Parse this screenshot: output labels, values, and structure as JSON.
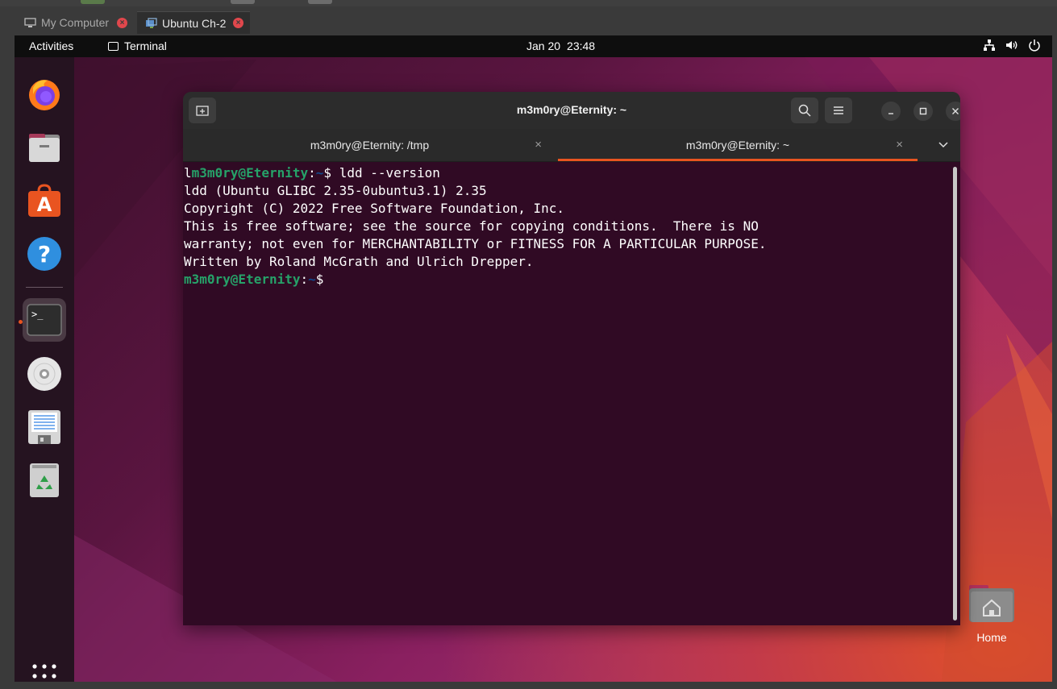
{
  "host": {
    "tabs": [
      {
        "label": "My Computer",
        "active": false
      },
      {
        "label": "Ubuntu Ch-2",
        "active": true
      }
    ]
  },
  "topbar": {
    "activities": "Activities",
    "app_name": "Terminal",
    "date": "Jan 20",
    "time": "23:48",
    "tray_icons": [
      "network-icon",
      "volume-icon",
      "power-icon"
    ]
  },
  "dock": {
    "items": [
      "firefox",
      "files",
      "app-center",
      "help",
      "terminal",
      "disc",
      "text-editor",
      "trash"
    ],
    "show_apps": "show-apps-grid"
  },
  "desktop": {
    "home_label": "Home"
  },
  "terminal": {
    "title": "m3m0ry@Eternity: ~",
    "tabs": [
      {
        "label": "m3m0ry@Eternity: /tmp",
        "active": false
      },
      {
        "label": "m3m0ry@Eternity: ~",
        "active": true
      }
    ],
    "lines": {
      "l1_prefix": "l",
      "l1_user": "m3m0ry@Eternity",
      "l1_colon": ":",
      "l1_path": "~",
      "l1_cmd": "$ ldd --version",
      "l2": "ldd (Ubuntu GLIBC 2.35-0ubuntu3.1) 2.35",
      "l3": "Copyright (C) 2022 Free Software Foundation, Inc.",
      "l4": "This is free software; see the source for copying conditions.  There is NO",
      "l5": "warranty; not even for MERCHANTABILITY or FITNESS FOR A PARTICULAR PURPOSE.",
      "l6": "Written by Roland McGrath and Ulrich Drepper.",
      "l7_user": "m3m0ry@Eternity",
      "l7_colon": ":",
      "l7_path": "~",
      "l7_prompt": "$"
    }
  },
  "colors": {
    "accent": "#e95420",
    "terminal_bg": "#300a24",
    "prompt_user": "#26a269",
    "prompt_path": "#12488b"
  }
}
